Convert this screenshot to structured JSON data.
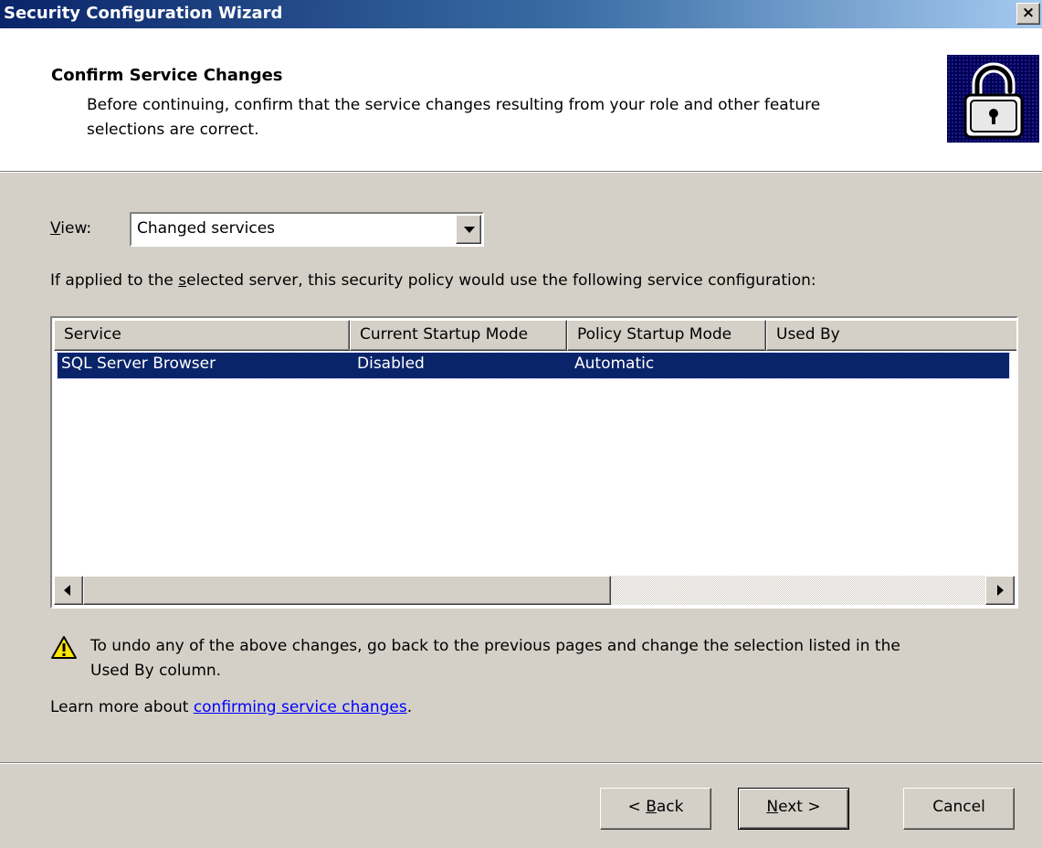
{
  "window": {
    "title": "Security Configuration Wizard",
    "close_glyph": "×"
  },
  "header": {
    "title": "Confirm Service Changes",
    "description_line1": "Before continuing, confirm that the service changes resulting from your role and other feature",
    "description_line2": "selections are correct.",
    "icon": "padlock-icon"
  },
  "view": {
    "label_accel": "V",
    "label_rest": "iew:",
    "selected": "Changed services"
  },
  "info": {
    "prefix": "If applied to the ",
    "accel": "s",
    "suffix": "elected server, this security policy would use the following service configuration:"
  },
  "table": {
    "columns": [
      "Service",
      "Current Startup Mode",
      "Policy Startup Mode",
      "Used By"
    ],
    "rows": [
      {
        "service": "SQL Server Browser",
        "current": "Disabled",
        "policy": "Automatic",
        "used_by": "",
        "selected": true
      }
    ]
  },
  "warning": {
    "icon": "warning-icon",
    "line1": "To undo any of the above changes, go back to the previous pages and change the selection listed in the",
    "line2": "Used By column."
  },
  "learn_more": {
    "prefix": "Learn more about ",
    "link": "confirming service changes",
    "suffix": "."
  },
  "buttons": {
    "back_pre": "< ",
    "back_accel": "B",
    "back_rest": "ack",
    "next_accel": "N",
    "next_rest": "ext >",
    "cancel": "Cancel"
  },
  "colors": {
    "face": "#d4d0c8",
    "selection": "#0a246a",
    "link": "#0000ff",
    "titlebar_start": "#0a246a",
    "titlebar_end": "#a6caf0"
  }
}
